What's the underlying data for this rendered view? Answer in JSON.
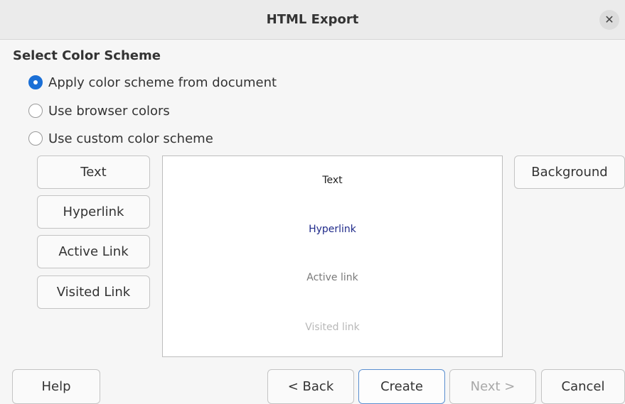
{
  "window": {
    "title": "HTML Export"
  },
  "section": {
    "title": "Select Color Scheme"
  },
  "radios": [
    {
      "label": "Apply color scheme from document",
      "checked": true
    },
    {
      "label": "Use browser colors",
      "checked": false
    },
    {
      "label": "Use custom color scheme",
      "checked": false
    }
  ],
  "color_buttons": {
    "text": "Text",
    "hyperlink": "Hyperlink",
    "active_link": "Active Link",
    "visited_link": "Visited Link",
    "background": "Background"
  },
  "preview": {
    "text": "Text",
    "hyperlink": "Hyperlink",
    "active_link": "Active link",
    "visited_link": "Visited link",
    "colors": {
      "text": "#222222",
      "hyperlink": "#1f2a8a",
      "active": "#7a7a7a",
      "visited": "#b8b8b8"
    }
  },
  "footer": {
    "help": "Help",
    "back": "< Back",
    "create": "Create",
    "next": "Next >",
    "cancel": "Cancel"
  },
  "colors": {
    "accent": "#1a6fd6"
  }
}
